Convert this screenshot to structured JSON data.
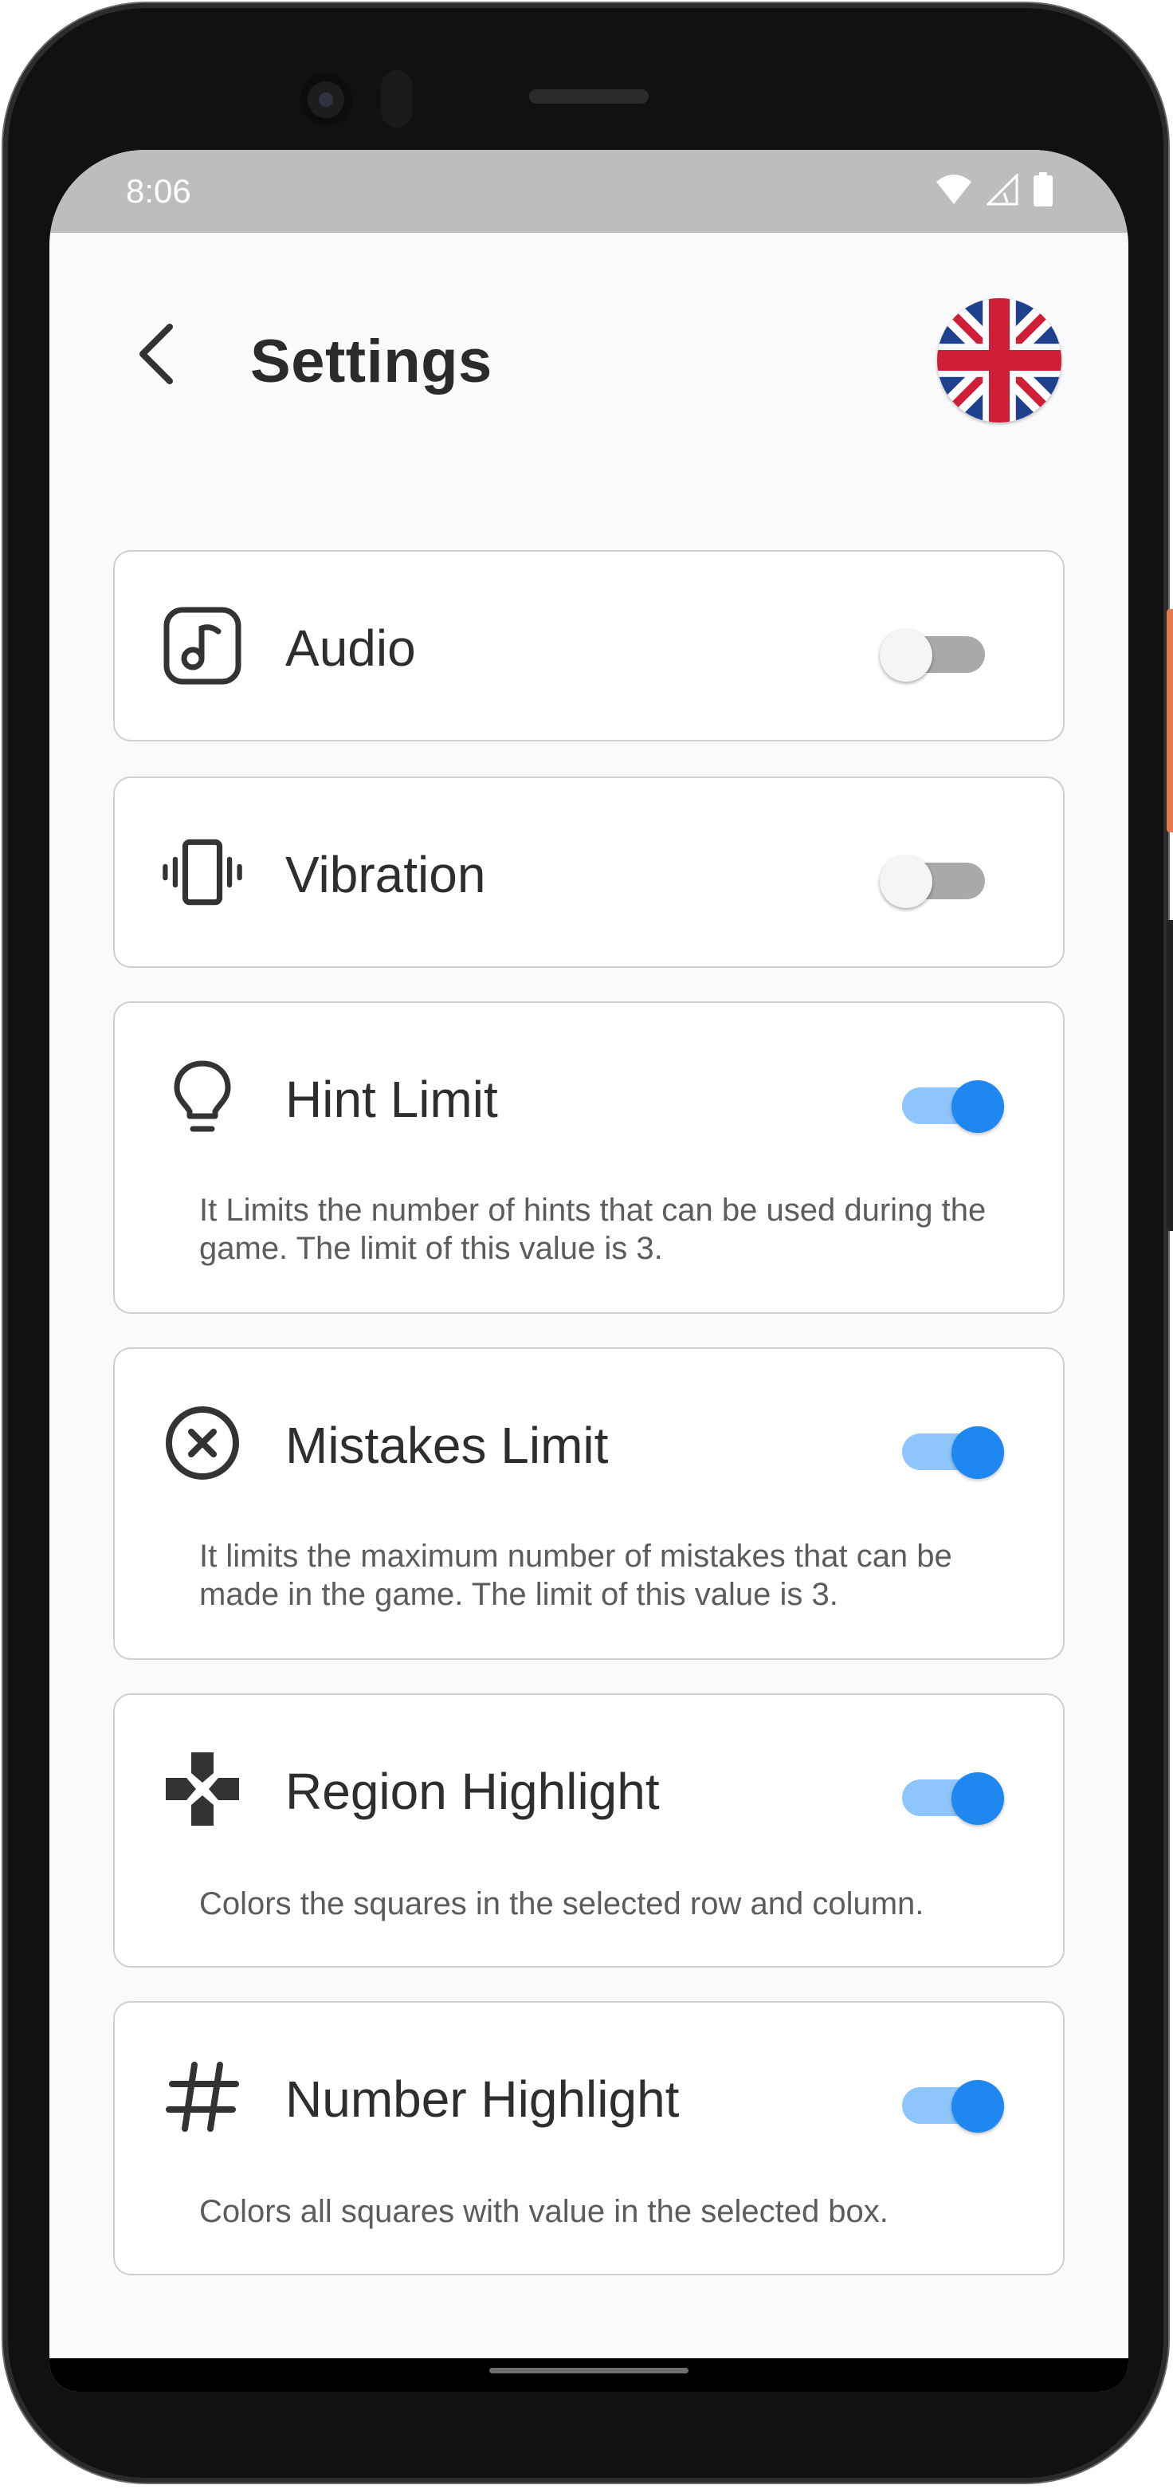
{
  "status_bar": {
    "time": "8:06",
    "icons": [
      "wifi-icon",
      "signal-icon",
      "battery-icon"
    ]
  },
  "header": {
    "title": "Settings",
    "back_icon": "chevron-left-icon",
    "language_flag": "uk-flag-icon"
  },
  "settings": [
    {
      "key": "audio",
      "label": "Audio",
      "icon": "music-note-icon",
      "enabled": false,
      "description": ""
    },
    {
      "key": "vibration",
      "label": "Vibration",
      "icon": "vibration-icon",
      "enabled": false,
      "description": ""
    },
    {
      "key": "hint_limit",
      "label": "Hint Limit",
      "icon": "lightbulb-icon",
      "enabled": true,
      "description": "It Limits the number of hints that can be used during the game. The limit of this value is 3."
    },
    {
      "key": "mistakes_limit",
      "label": "Mistakes Limit",
      "icon": "close-circle-icon",
      "enabled": true,
      "description": "It limits the maximum number of mistakes that can be made in the game. The limit of this value is 3."
    },
    {
      "key": "region_highlight",
      "label": "Region Highlight",
      "icon": "gamepad-icon",
      "enabled": true,
      "description": "Colors the squares in the selected row and column."
    },
    {
      "key": "number_highlight",
      "label": "Number Highlight",
      "icon": "hashtag-icon",
      "enabled": true,
      "description": "Colors all squares with value in the selected box."
    }
  ],
  "colors": {
    "toggle_on_thumb": "#1e88f0",
    "toggle_on_track": "#8ec5fb",
    "toggle_off_thumb": "#f5f5f5",
    "toggle_off_track": "#a9a9a9",
    "card_border": "#cfcfcf",
    "background": "#fafafa"
  }
}
